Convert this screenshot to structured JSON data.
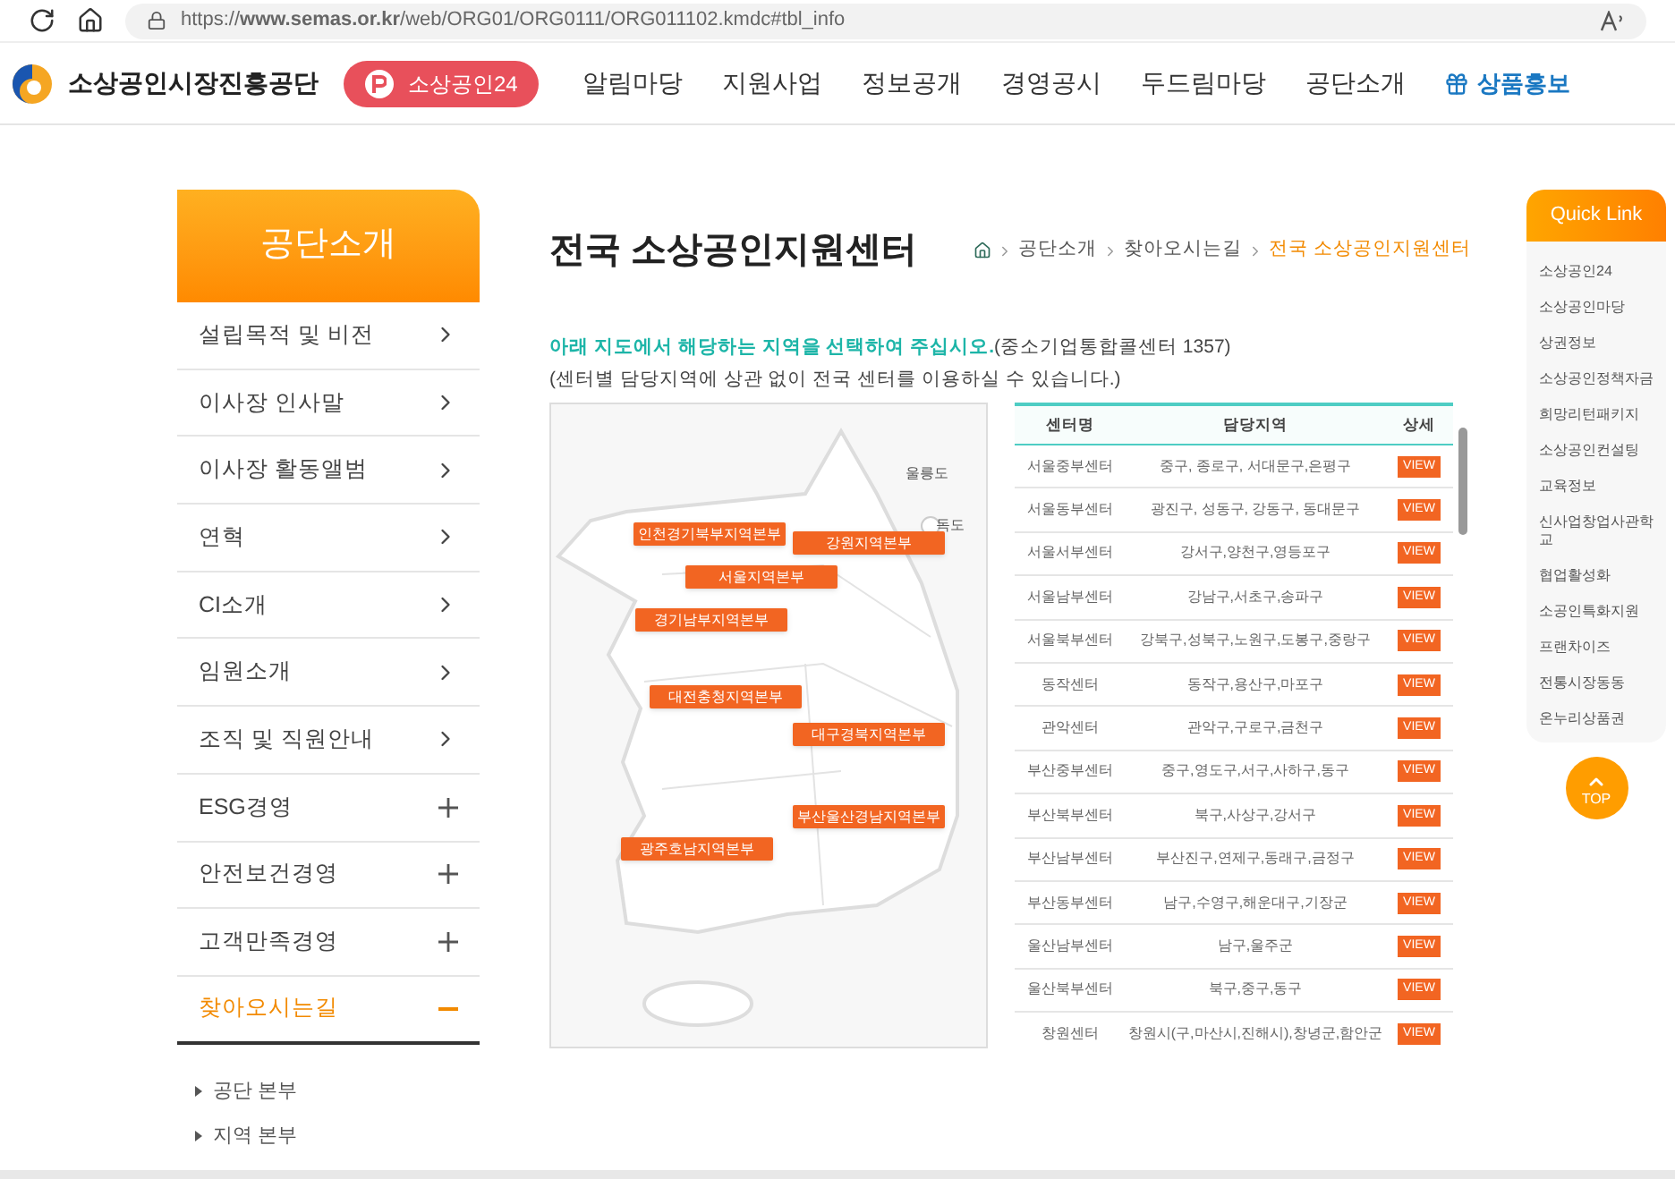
{
  "browser": {
    "url": "https://**www.semas.or.kr**/web/ORG01/ORG0111/ORG011102.kmdc#tbl_info"
  },
  "header": {
    "logo_text": "소상공인시장진흥공단",
    "badge": "소상공인24",
    "nav": [
      {
        "label": "알림마당",
        "kind": "plain"
      },
      {
        "label": "지원사업",
        "kind": "plain"
      },
      {
        "label": "정보공개",
        "kind": "plain"
      },
      {
        "label": "경영공시",
        "kind": "plain"
      },
      {
        "label": "두드림마당",
        "kind": "plain"
      },
      {
        "label": "공단소개",
        "kind": "plain"
      },
      {
        "label": "상품홍보",
        "kind": "gift"
      }
    ]
  },
  "sidebar": {
    "title": "공단소개",
    "items": [
      {
        "label": "설립목적 및 비전",
        "kind": "link",
        "selected": false
      },
      {
        "label": "이사장 인사말",
        "kind": "link",
        "selected": false
      },
      {
        "label": "이사장 활동앨범",
        "kind": "link",
        "selected": false
      },
      {
        "label": "연혁",
        "kind": "link",
        "selected": false
      },
      {
        "label": "CI소개",
        "kind": "link",
        "selected": false
      },
      {
        "label": "임원소개",
        "kind": "link",
        "selected": false
      },
      {
        "label": "조직 및 직원안내",
        "kind": "link",
        "selected": false
      },
      {
        "label": "ESG경영",
        "kind": "expand",
        "selected": false
      },
      {
        "label": "안전보건경영",
        "kind": "expand",
        "selected": false
      },
      {
        "label": "고객만족경영",
        "kind": "expand",
        "selected": false
      },
      {
        "label": "찾아오시는길",
        "kind": "expand",
        "selected": true
      }
    ],
    "sub_items": [
      "공단 본부",
      "지역 본부"
    ]
  },
  "page": {
    "title": "전국 소상공인지원센터",
    "breadcrumb": [
      "공단소개",
      "찾아오시는길",
      "전국 소상공인지원센터"
    ],
    "notice_highlight": "아래 지도에서 해당하는 지역을 선택하여 주십시오.",
    "notice_rest": "(중소기업통합콜센터 1357)",
    "notice_2": "(센터별 담당지역에 상관 없이 전국 센터를 이용하실 수 있습니다.)"
  },
  "map": {
    "islands": [
      "울릉도",
      "독도"
    ],
    "regions": [
      "인천경기북부지역본부",
      "강원지역본부",
      "서울지역본부",
      "경기남부지역본부",
      "대전충청지역본부",
      "대구경북지역본부",
      "부산울산경남지역본부",
      "광주호남지역본부"
    ]
  },
  "table": {
    "columns": [
      "센터명",
      "담당지역",
      "상세"
    ],
    "rows": [
      [
        "서울중부센터",
        "중구, 종로구, 서대문구,은평구",
        "VIEW"
      ],
      [
        "서울동부센터",
        "광진구, 성동구, 강동구, 동대문구",
        "VIEW"
      ],
      [
        "서울서부센터",
        "강서구,양천구,영등포구",
        "VIEW"
      ],
      [
        "서울남부센터",
        "강남구,서초구,송파구",
        "VIEW"
      ],
      [
        "서울북부센터",
        "강북구,성북구,노원구,도봉구,중랑구",
        "VIEW"
      ],
      [
        "동작센터",
        "동작구,용산구,마포구",
        "VIEW"
      ],
      [
        "관악센터",
        "관악구,구로구,금천구",
        "VIEW"
      ],
      [
        "부산중부센터",
        "중구,영도구,서구,사하구,동구",
        "VIEW"
      ],
      [
        "부산북부센터",
        "북구,사상구,강서구",
        "VIEW"
      ],
      [
        "부산남부센터",
        "부산진구,연제구,동래구,금정구",
        "VIEW"
      ],
      [
        "부산동부센터",
        "남구,수영구,해운대구,기장군",
        "VIEW"
      ],
      [
        "울산남부센터",
        "남구,울주군",
        "VIEW"
      ],
      [
        "울산북부센터",
        "북구,중구,동구",
        "VIEW"
      ],
      [
        "창원센터",
        "창원시(구,마산시,진해시),창녕군,함안군",
        "VIEW"
      ]
    ]
  },
  "quick_link": {
    "title": "Quick Link",
    "items": [
      "소상공인24",
      "소상공인마당",
      "상권정보",
      "소상공인정책자금",
      "희망리턴패키지",
      "소상공인컨설팅",
      "교육정보",
      "신사업창업사관학교",
      "협업활성화",
      "소공인특화지원",
      "프랜차이즈",
      "전통시장동동",
      "온누리상품권"
    ],
    "top": "TOP"
  }
}
